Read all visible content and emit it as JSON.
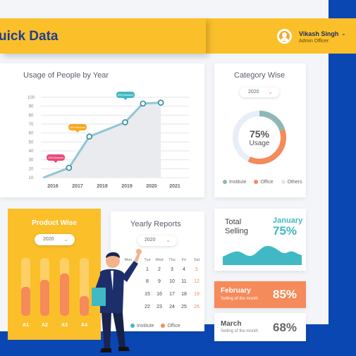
{
  "header": {
    "app_title": "uick Data",
    "user_name": "Vikash Singh",
    "user_role": "Admin Officer"
  },
  "colors": {
    "header_yellow": "#fbbf2a",
    "brand_blue": "#0b47b3",
    "teal": "#40b9c4",
    "orange": "#f58a5b",
    "pink": "#e84b7a"
  },
  "icons": [
    "avatar-icon",
    "chevron-down-icon"
  ],
  "usage_card": {
    "title": "Usage of People by Year",
    "bubbles": [
      "20% Enhanced",
      "40% Enhanced",
      "80% Enhanced"
    ]
  },
  "chart_data": {
    "type": "area",
    "title": "Usage of People by Year",
    "y_ticks": [
      "100",
      "90",
      "80",
      "70",
      "60",
      "50",
      "40",
      "30",
      "20",
      "10"
    ],
    "x_ticks": [
      "2016",
      "2017",
      "2018",
      "2019",
      "2020",
      "2021"
    ],
    "ylim": [
      10,
      100
    ],
    "points": [
      {
        "x": 2015.6,
        "y": 10
      },
      {
        "x": 2016.6,
        "y": 21
      },
      {
        "x": 2017.4,
        "y": 56
      },
      {
        "x": 2018.8,
        "y": 72
      },
      {
        "x": 2019.5,
        "y": 93
      },
      {
        "x": 2020.2,
        "y": 94
      }
    ],
    "grid": true
  },
  "category_card": {
    "title": "Category Wise",
    "year": "2020",
    "center_value": "75%",
    "center_label": "Usage",
    "legend": [
      "Institute",
      "Office",
      "Others"
    ],
    "segments": [
      {
        "name": "Institute",
        "value": 20,
        "color": "#8fb8b4"
      },
      {
        "name": "Office",
        "value": 37,
        "color": "#f58a5b"
      },
      {
        "name": "Others",
        "value": 43,
        "color": "#e8eef8"
      }
    ]
  },
  "product_card": {
    "title": "Product Wise",
    "year": "2020",
    "bars": [
      {
        "label": "A1",
        "total": 100,
        "value": 50
      },
      {
        "label": "A2",
        "total": 100,
        "value": 62
      },
      {
        "label": "A3",
        "total": 100,
        "value": 73
      },
      {
        "label": "A4",
        "total": 100,
        "value": 34
      }
    ]
  },
  "yearly_card": {
    "title": "Yearly Reports",
    "year": "2020",
    "weekdays": [
      "Mon",
      "Tue",
      "Wed",
      "Thu",
      "Fri",
      "Sat"
    ],
    "rows": [
      [
        "",
        "1",
        "2",
        "3",
        "4",
        "5"
      ],
      [
        "",
        "8",
        "9",
        "10",
        "11",
        "12"
      ],
      [
        "",
        "15",
        "16",
        "17",
        "18",
        "19"
      ],
      [
        "",
        "22",
        "23",
        "24",
        "25",
        "26"
      ]
    ],
    "legend": [
      "Institute",
      "Office"
    ]
  },
  "total_card": {
    "title_line1": "Total",
    "title_line2": "Selling",
    "month": "January",
    "value": "75%"
  },
  "february_card": {
    "month": "February",
    "caption": "Selling of the month",
    "value": "85%"
  },
  "march_card": {
    "month": "March",
    "caption": "Selling of the month",
    "value": "68%"
  }
}
